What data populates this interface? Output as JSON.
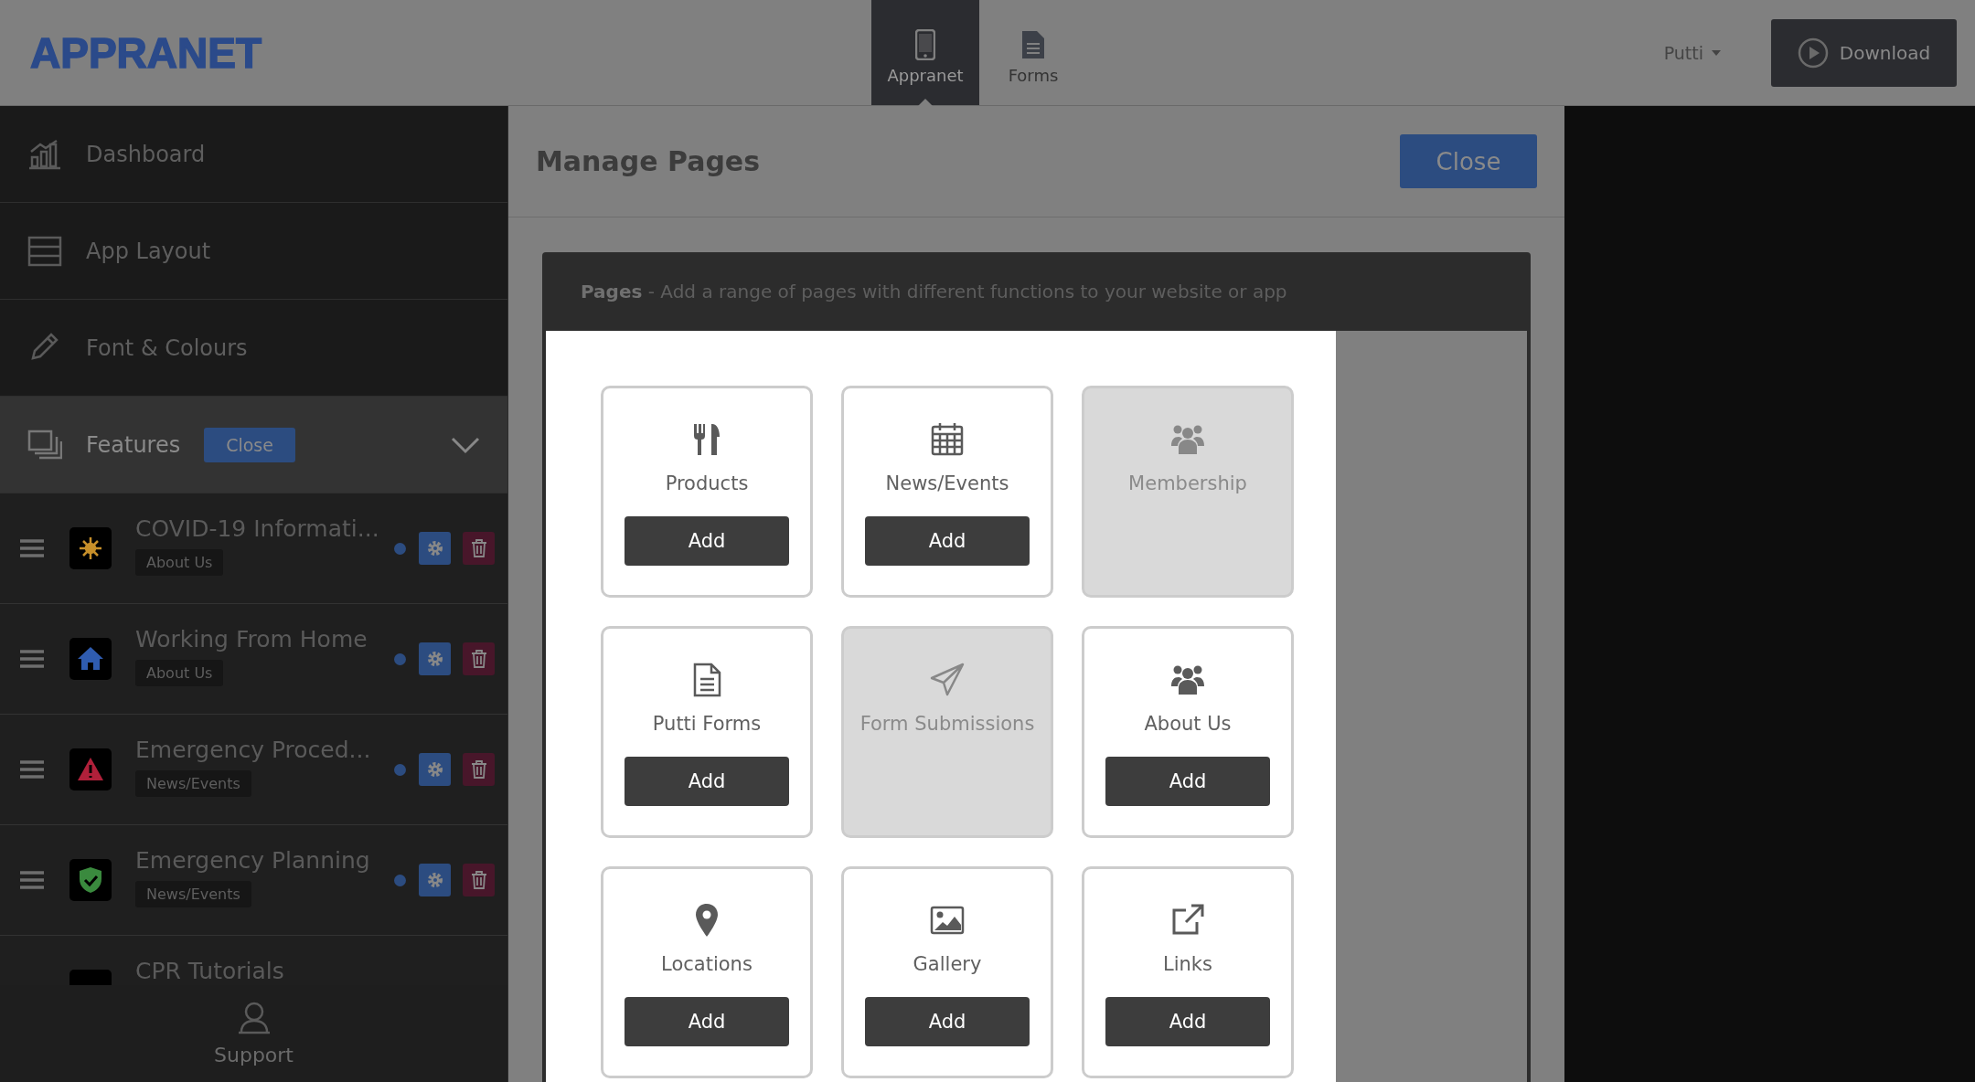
{
  "topbar": {
    "logo": "APPRANET",
    "tabs": [
      {
        "label": "Appranet",
        "selected": true
      },
      {
        "label": "Forms",
        "selected": false
      }
    ],
    "user": "Putti",
    "download": "Download"
  },
  "sidebar": {
    "nav": [
      {
        "label": "Dashboard",
        "selected": false
      },
      {
        "label": "App Layout",
        "selected": false
      },
      {
        "label": "Font & Colours",
        "selected": false
      },
      {
        "label": "Features",
        "selected": true,
        "expanded": true
      }
    ],
    "close_button": "Close",
    "features": [
      {
        "title": "COVID-19 Informati...",
        "tag": "About Us",
        "color": "#c8902a"
      },
      {
        "title": "Working From Home",
        "tag": "About Us",
        "color": "#2f5cb0"
      },
      {
        "title": "Emergency Proced...",
        "tag": "News/Events",
        "color": "#b0203a"
      },
      {
        "title": "Emergency Planning",
        "tag": "News/Events",
        "color": "#3a8a3e"
      },
      {
        "title": "CPR Tutorials"
      }
    ],
    "support": "Support"
  },
  "panel": {
    "title": "Manage Pages",
    "close": "Close",
    "section_title": "Pages",
    "section_text": " - Add a range of pages with different functions to your website or app",
    "pages": [
      {
        "label": "Products",
        "disabled": false,
        "button": "Add"
      },
      {
        "label": "News/Events",
        "disabled": false,
        "button": "Add"
      },
      {
        "label": "Membership",
        "disabled": true
      },
      {
        "label": "Putti Forms",
        "disabled": false,
        "button": "Add"
      },
      {
        "label": "Form Submissions",
        "disabled": true
      },
      {
        "label": "About Us",
        "disabled": false,
        "button": "Add"
      },
      {
        "label": "Locations",
        "disabled": false,
        "button": "Add"
      },
      {
        "label": "Gallery",
        "disabled": false,
        "button": "Add"
      },
      {
        "label": "Links",
        "disabled": false,
        "button": "Add"
      }
    ]
  }
}
